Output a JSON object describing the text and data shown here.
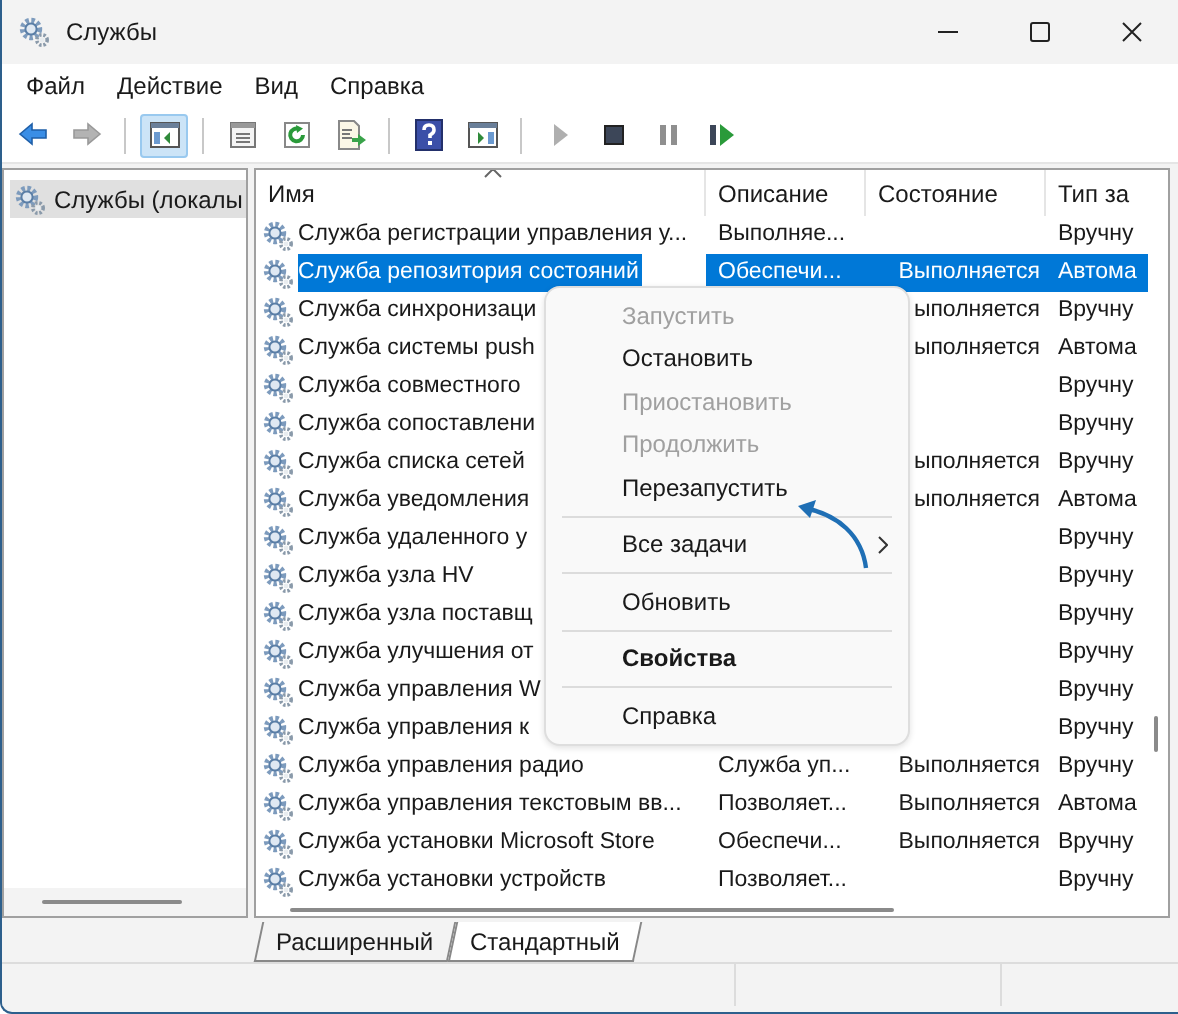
{
  "window": {
    "title": "Службы"
  },
  "menu_bar": [
    "Файл",
    "Действие",
    "Вид",
    "Справка"
  ],
  "toolbar": [
    {
      "kind": "back",
      "disabled": false,
      "selected": false
    },
    {
      "kind": "forward",
      "disabled": true,
      "selected": false
    },
    {
      "kind": "separator"
    },
    {
      "kind": "tree",
      "disabled": false,
      "selected": true
    },
    {
      "kind": "separator"
    },
    {
      "kind": "properties",
      "disabled": false,
      "selected": false
    },
    {
      "kind": "refresh",
      "disabled": false,
      "selected": false
    },
    {
      "kind": "export",
      "disabled": false,
      "selected": false
    },
    {
      "kind": "separator"
    },
    {
      "kind": "help",
      "disabled": false,
      "selected": false
    },
    {
      "kind": "console",
      "disabled": false,
      "selected": false
    },
    {
      "kind": "separator"
    },
    {
      "kind": "play",
      "disabled": true,
      "selected": false
    },
    {
      "kind": "stop",
      "disabled": false,
      "selected": false
    },
    {
      "kind": "pause",
      "disabled": true,
      "selected": false
    },
    {
      "kind": "resume",
      "disabled": false,
      "selected": false
    }
  ],
  "tree": [
    {
      "label": "Службы (локалы",
      "selected": true
    }
  ],
  "table": {
    "columns": [
      "Имя",
      "Описание",
      "Состояние",
      "Тип за"
    ],
    "rows": [
      {
        "name": "Служба регистрации управления у...",
        "description": "Выполняе...",
        "startup": "Вручну",
        "selected": false
      },
      {
        "name": "Служба репозитория состояний",
        "description": "Обеспечи...",
        "status": "Выполняется",
        "startup": "Автома",
        "selected": true
      },
      {
        "name": "Служба синхронизаци",
        "status": "ыполняется",
        "startup": "Вручну",
        "selected": false
      },
      {
        "name": "Служба системы push",
        "status": "ыполняется",
        "startup": "Автома",
        "selected": false
      },
      {
        "name": "Служба совместного",
        "startup": "Вручну",
        "selected": false
      },
      {
        "name": "Служба сопоставлени",
        "startup": "Вручну",
        "selected": false
      },
      {
        "name": "Служба списка сетей",
        "status": "ыполняется",
        "startup": "Вручну",
        "selected": false
      },
      {
        "name": "Служба уведомления",
        "status": "ыполняется",
        "startup": "Автома",
        "selected": false
      },
      {
        "name": "Служба удаленного у",
        "startup": "Вручну",
        "selected": false
      },
      {
        "name": "Служба узла HV",
        "startup": "Вручну",
        "selected": false
      },
      {
        "name": "Служба узла поставщ",
        "startup": "Вручну",
        "selected": false
      },
      {
        "name": "Служба улучшения от",
        "startup": "Вручну",
        "selected": false
      },
      {
        "name": "Служба управления W",
        "startup": "Вручну",
        "selected": false
      },
      {
        "name": "Служба управления к",
        "startup": "Вручну",
        "selected": false
      },
      {
        "name": "Служба управления радио",
        "description": "Служба уп...",
        "status": "Выполняется",
        "startup": "Вручну",
        "selected": false
      },
      {
        "name": "Служба управления текстовым вв...",
        "description": "Позволяет...",
        "status": "Выполняется",
        "startup": "Автома",
        "selected": false
      },
      {
        "name": "Служба установки Microsoft Store",
        "description": "Обеспечи...",
        "status": "Выполняется",
        "startup": "Вручну",
        "selected": false
      },
      {
        "name": "Служба установки устройств",
        "description": "Позволяет...",
        "startup": "Вручну",
        "selected": false
      }
    ]
  },
  "context_menu": {
    "items": [
      {
        "kind": "item",
        "label": "Запустить",
        "disabled": true,
        "default": false,
        "submenu": false
      },
      {
        "kind": "item",
        "label": "Остановить",
        "disabled": false,
        "default": false,
        "submenu": false
      },
      {
        "kind": "item",
        "label": "Приостановить",
        "disabled": true,
        "default": false,
        "submenu": false
      },
      {
        "kind": "item",
        "label": "Продолжить",
        "disabled": true,
        "default": false,
        "submenu": false
      },
      {
        "kind": "item",
        "label": "Перезапустить",
        "disabled": false,
        "default": false,
        "submenu": false
      },
      {
        "kind": "separator"
      },
      {
        "kind": "item",
        "label": "Все задачи",
        "disabled": false,
        "default": false,
        "submenu": true
      },
      {
        "kind": "separator"
      },
      {
        "kind": "item",
        "label": "Обновить",
        "disabled": false,
        "default": false,
        "submenu": false
      },
      {
        "kind": "separator"
      },
      {
        "kind": "item",
        "label": "Свойства",
        "disabled": false,
        "default": true,
        "submenu": false
      },
      {
        "kind": "separator"
      },
      {
        "kind": "item",
        "label": "Справка",
        "disabled": false,
        "default": false,
        "submenu": false
      }
    ]
  },
  "tabs": [
    {
      "label": "Расширенный",
      "selected": false
    },
    {
      "label": "Стандартный",
      "selected": true
    }
  ]
}
